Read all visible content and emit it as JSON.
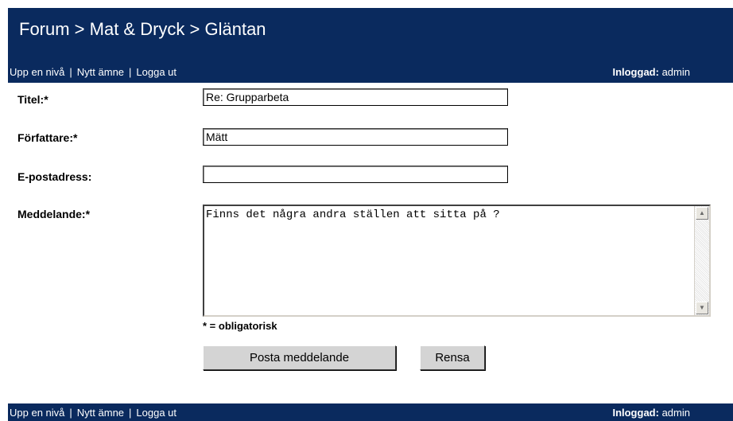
{
  "header": {
    "breadcrumb": "Forum > Mat & Dryck > Gläntan"
  },
  "nav": {
    "up_level": "Upp en nivå",
    "new_topic": "Nytt ämne",
    "logout": "Logga ut",
    "separator": "|",
    "logged_in_label": "Inloggad:",
    "logged_in_user": "admin"
  },
  "form": {
    "title_label": "Titel:*",
    "title_value": "Re: Grupparbeta",
    "author_label": "Författare:*",
    "author_value": "Mätt",
    "email_label": "E-postadress:",
    "email_value": "",
    "message_label": "Meddelande:*",
    "message_value": "Finns det några andra ställen att sitta på ?",
    "required_note": "* = obligatorisk",
    "submit_label": "Posta meddelande",
    "reset_label": "Rensa"
  },
  "icons": {
    "scroll_up": "scroll-up-arrow",
    "scroll_down": "scroll-down-arrow"
  },
  "colors": {
    "header_bg": "#0a2a5e",
    "button_bg": "#d4d4d4"
  }
}
